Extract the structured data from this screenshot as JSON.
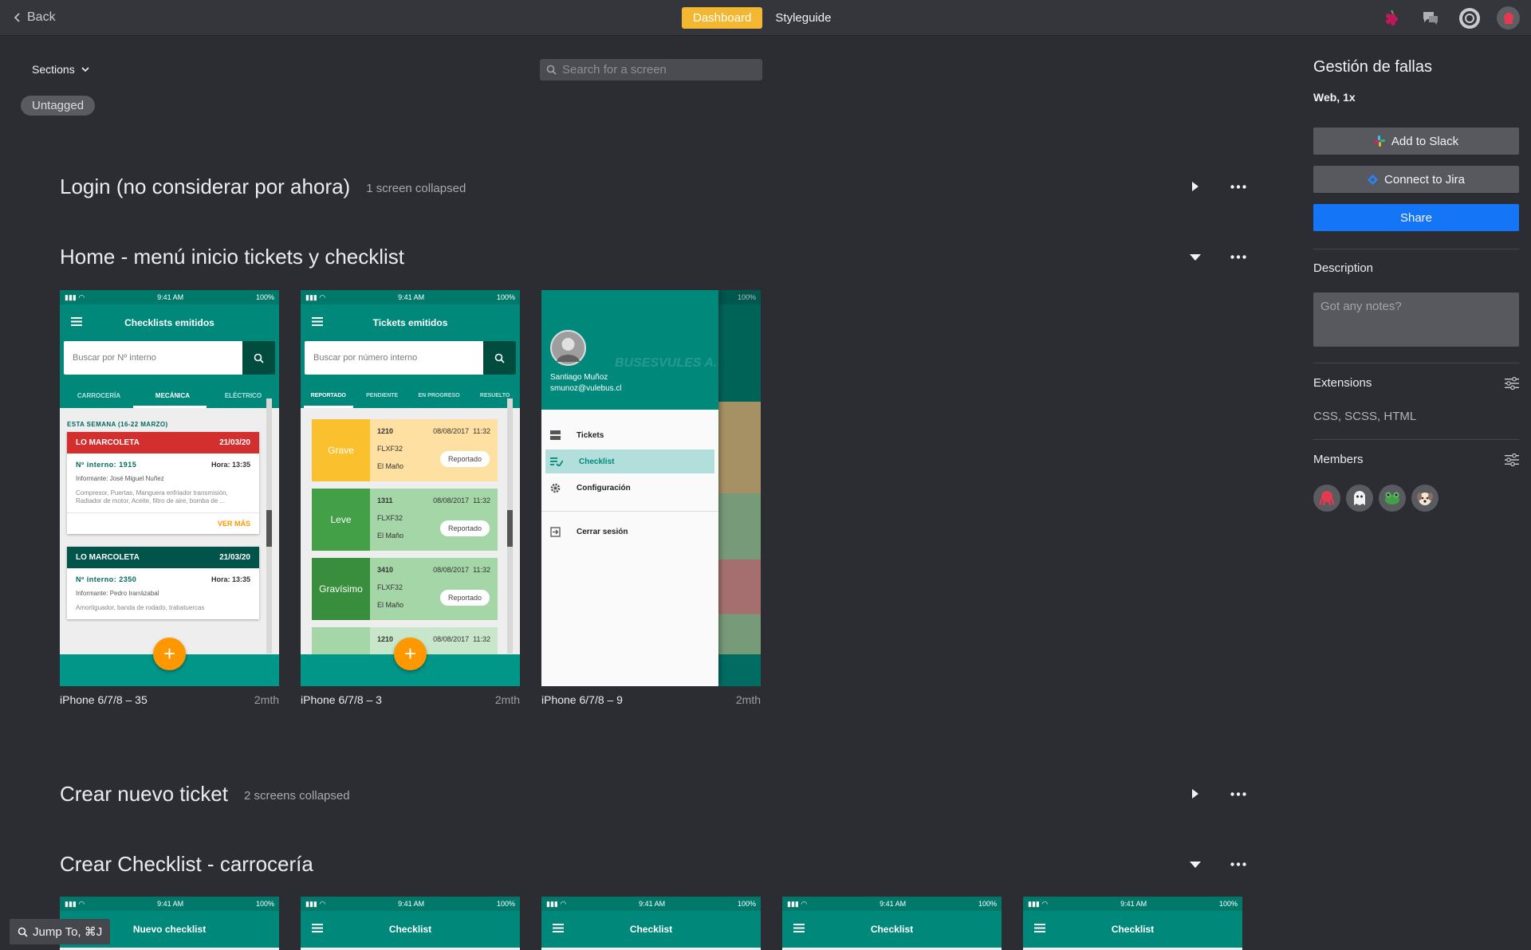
{
  "topbar": {
    "back_label": "Back",
    "tabs": [
      "Dashboard",
      "Styleguide"
    ],
    "active_tab": "Dashboard",
    "accent": "#f4b731"
  },
  "toolbar": {
    "sections_label": "Sections",
    "untagged_label": "Untagged",
    "search_placeholder": "Search for a screen"
  },
  "sections": [
    {
      "title": "Login (no considerar por ahora)",
      "count": "1 screen collapsed",
      "state": "collapsed"
    },
    {
      "title": "Home - menú inicio tickets y checklist",
      "count": "",
      "state": "expanded",
      "screens": [
        {
          "name": "iPhone 6/7/8 – 35",
          "time": "2mth"
        },
        {
          "name": "iPhone 6/7/8 – 3",
          "time": "2mth"
        },
        {
          "name": "iPhone 6/7/8 – 9",
          "time": "2mth"
        }
      ]
    },
    {
      "title": "Crear nuevo ticket",
      "count": "2 screens collapsed",
      "state": "collapsed"
    },
    {
      "title": "Crear Checklist - carrocería",
      "count": "",
      "state": "expanded",
      "screens_titles": [
        "Nuevo checklist",
        "Checklist",
        "Checklist",
        "Checklist",
        "Checklist"
      ]
    }
  ],
  "phone": {
    "time": "9:41 AM",
    "battery": "100%",
    "checklists": {
      "title": "Checklists emitidos",
      "search_placeholder": "Buscar por Nº interno",
      "tabs": [
        "CARROCERÍA",
        "MECÁNICA",
        "ELÉCTRICO"
      ],
      "week": "ESTA SEMANA (16-22 MARZO)",
      "cards": [
        {
          "company": "LO MARCOLETA",
          "date": "21/03/20",
          "color": "#d32f2f",
          "interno": "Nº interno: 1915",
          "hora": "Hora: 13:35",
          "informante": "Informante: José Miguel Nuñez",
          "desc": "Compresor, Puertas, Manguera enfriador transmisión, Radiador de motor, Aceite, filtro de aire, bomba de ...",
          "more": "VER MÁS"
        },
        {
          "company": "LO MARCOLETA",
          "date": "21/03/20",
          "color": "#00695c",
          "interno": "Nº interno: 2350",
          "hora": "Hora: 13:35",
          "informante": "Informante: Pedro Irarrázabal",
          "desc": "Amortiguador, banda de rodado, trabatuercas"
        }
      ]
    },
    "tickets": {
      "title": "Tickets emitidos",
      "search_placeholder": "Buscar por número interno",
      "tabs": [
        "REPORTADO",
        "PENDIENTE",
        "EN PROGRESO",
        "RESUELTO"
      ],
      "items": [
        {
          "severity": "Grave",
          "num": "1210",
          "date": "08/08/2017",
          "time": "11:32",
          "plate": "FLXF32",
          "place": "El Maño",
          "status": "Reportado",
          "dark": "#fbc02d",
          "light": "#ffe0a3"
        },
        {
          "severity": "Leve",
          "num": "1311",
          "date": "08/08/2017",
          "time": "11:32",
          "plate": "FLXF32",
          "place": "El Maño",
          "status": "Reportado",
          "dark": "#43a047",
          "light": "#a5d6a7"
        },
        {
          "severity": "Gravísimo",
          "num": "3410",
          "date": "08/08/2017",
          "time": "11:32",
          "plate": "FLXF32",
          "place": "El Maño",
          "status": "Reportado",
          "dark": "#388e3c",
          "light": "#a5d6a7"
        }
      ],
      "partial": {
        "num": "1210",
        "date": "08/08/2017",
        "time": "11:32"
      }
    },
    "drawer": {
      "user_name": "Santiago Muñoz",
      "user_email": "smunoz@vulebus.cl",
      "brand": "BUSESVULES A.",
      "items": [
        "Tickets",
        "Checklist",
        "Configuración",
        "Cerrar sesión"
      ],
      "selected": "Checklist"
    }
  },
  "sidebar": {
    "project_title": "Gestión de fallas",
    "project_sub": "Web, 1x",
    "slack_label": "Add to Slack",
    "jira_label": "Connect to Jira",
    "share_label": "Share",
    "description_label": "Description",
    "notes_placeholder": "Got any notes?",
    "extensions_label": "Extensions",
    "extensions_value": "CSS, SCSS, HTML",
    "members_label": "Members",
    "share_color": "#1475f6"
  },
  "jump_label": "Jump To, ⌘J"
}
